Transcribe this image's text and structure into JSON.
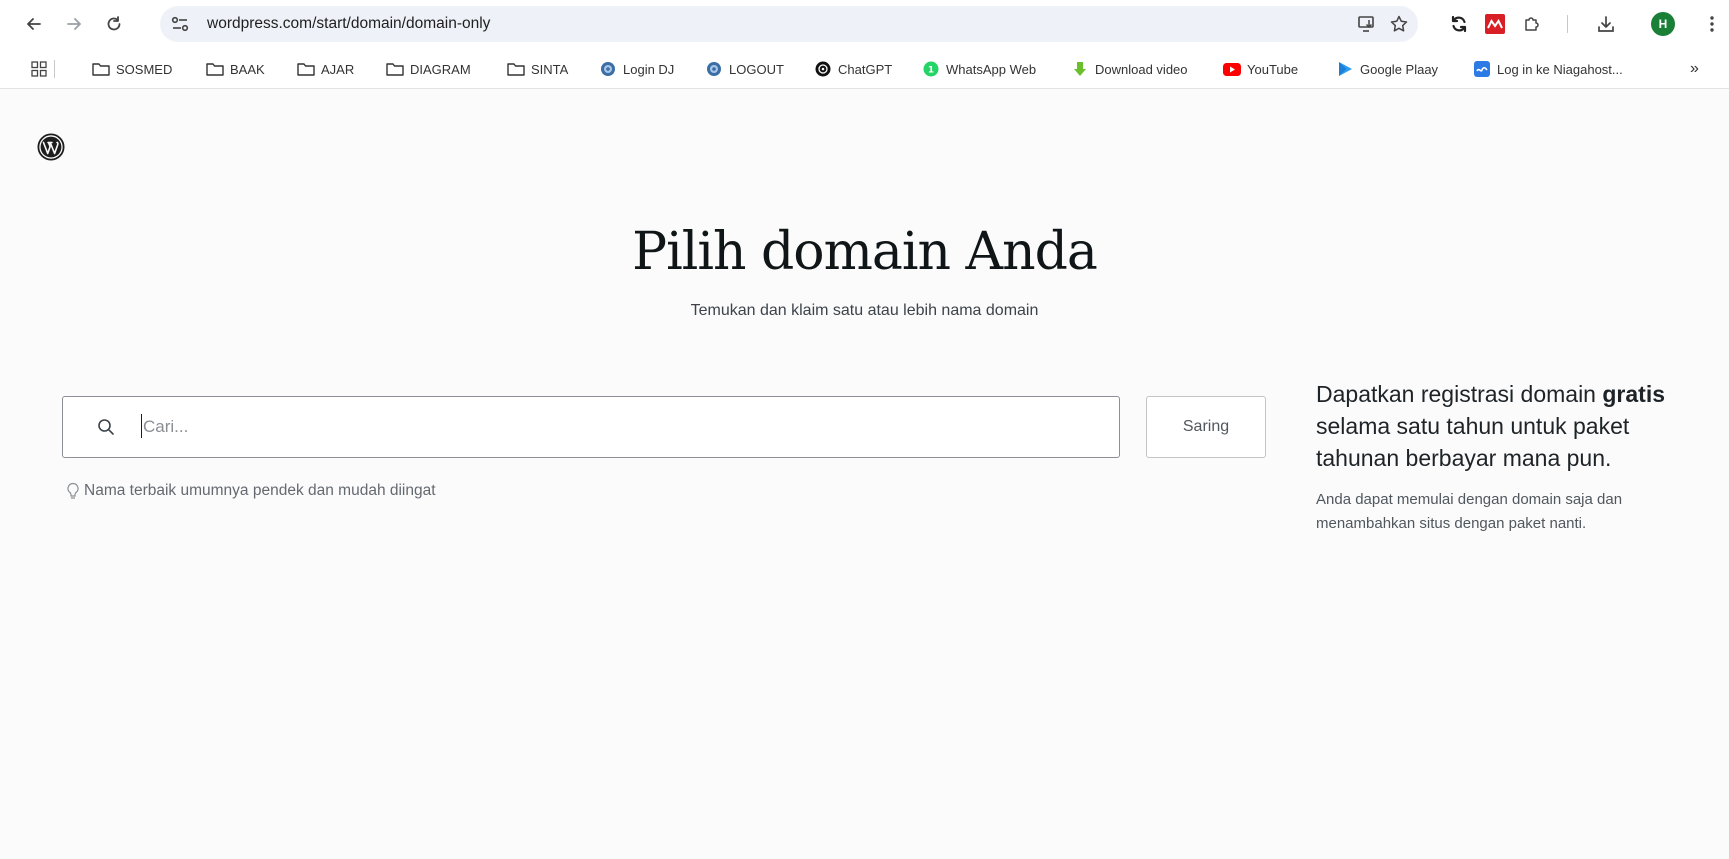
{
  "browser": {
    "url": "wordpress.com/start/domain/domain-only",
    "avatar_initial": "H",
    "bookmarks_overflow": "»",
    "bookmarks": [
      {
        "label": "SOSMED",
        "icon": "folder-icon"
      },
      {
        "label": "BAAK",
        "icon": "folder-icon"
      },
      {
        "label": "AJAR",
        "icon": "folder-icon"
      },
      {
        "label": "DIAGRAM",
        "icon": "folder-icon"
      },
      {
        "label": "SINTA",
        "icon": "folder-icon"
      },
      {
        "label": "Login DJ",
        "icon": "globe-icon"
      },
      {
        "label": "LOGOUT",
        "icon": "globe-icon"
      },
      {
        "label": "ChatGPT",
        "icon": "chatgpt-icon"
      },
      {
        "label": "WhatsApp Web",
        "icon": "whatsapp-icon"
      },
      {
        "label": "Download video",
        "icon": "download-arrow-icon"
      },
      {
        "label": "YouTube",
        "icon": "youtube-icon"
      },
      {
        "label": "Google Plaay",
        "icon": "google-play-icon"
      },
      {
        "label": "Log in ke Niagahost...",
        "icon": "niagahoster-icon"
      }
    ]
  },
  "page": {
    "title": "Pilih domain Anda",
    "subtitle": "Temukan dan klaim satu atau lebih nama domain",
    "search": {
      "placeholder": "Cari...",
      "value": ""
    },
    "filter_label": "Saring",
    "hint": "Nama terbaik umumnya pendek dan mudah diingat",
    "promo": {
      "title_before": "Dapatkan registrasi domain ",
      "title_bold": "gratis",
      "title_after": " selama satu tahun untuk paket tahunan berbayar mana pun.",
      "text": "Anda dapat memulai dengan domain saja dan menambahkan situs dengan paket nanti."
    }
  },
  "colors": {
    "page_background": "#fbfbfb",
    "omnibox_background": "#eef1f8",
    "avatar_green": "#1a7f37",
    "youtube_red": "#ff0000",
    "whatsapp_green": "#25d366"
  }
}
